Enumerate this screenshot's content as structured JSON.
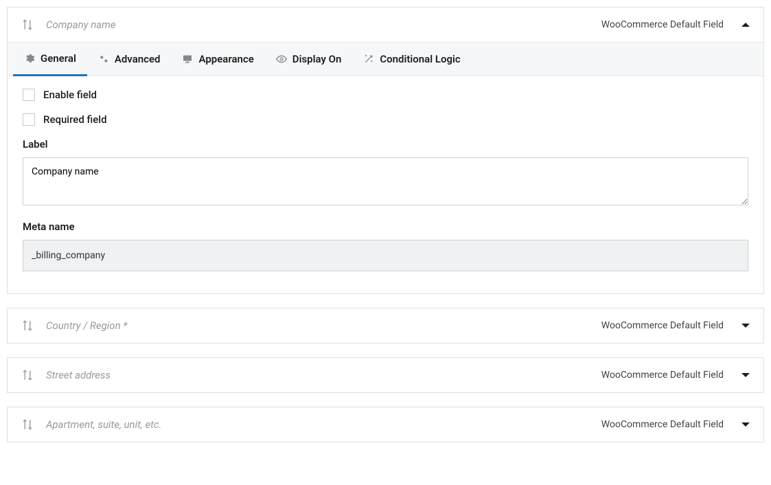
{
  "fields": [
    {
      "title": "Company name",
      "badge": "WooCommerce Default Field",
      "expanded": true,
      "panel": {
        "enable_label": "Enable field",
        "required_label": "Required field",
        "label_field_label": "Label",
        "label_value": "Company name",
        "meta_label": "Meta name",
        "meta_value": "_billing_company"
      }
    },
    {
      "title": "Country / Region *",
      "badge": "WooCommerce Default Field",
      "expanded": false
    },
    {
      "title": "Street address",
      "badge": "WooCommerce Default Field",
      "expanded": false
    },
    {
      "title": "Apartment, suite, unit, etc.",
      "badge": "WooCommerce Default Field",
      "expanded": false
    }
  ],
  "tabs": {
    "general": "General",
    "advanced": "Advanced",
    "appearance": "Appearance",
    "display_on": "Display On",
    "conditional": "Conditional Logic"
  }
}
